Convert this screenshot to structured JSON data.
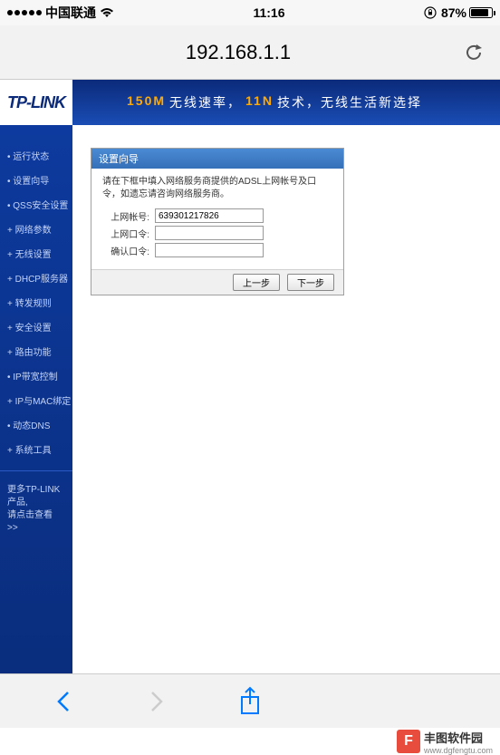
{
  "status": {
    "carrier": "中国联通",
    "time": "11:16",
    "battery_pct": "87%"
  },
  "browser": {
    "url": "192.168.1.1"
  },
  "router": {
    "logo": "TP-LINK",
    "banner": {
      "h1": "150M",
      "t1": "无线速率，",
      "h2": "11N",
      "t2": "技术，无线生活新选择"
    },
    "sidebar": {
      "items": [
        "运行状态",
        "设置向导",
        "QSS安全设置",
        "网络参数",
        "无线设置",
        "DHCP服务器",
        "转发规则",
        "安全设置",
        "路由功能",
        "IP带宽控制",
        "IP与MAC绑定",
        "动态DNS",
        "系统工具"
      ],
      "more_line1": "更多TP-LINK产品,",
      "more_line2": "请点击查看 >>"
    },
    "wizard": {
      "header": "设置向导",
      "hint": "请在下框中填入网络服务商提供的ADSL上网帐号及口令，如遗忘请咨询网络服务商。",
      "labels": {
        "account": "上网帐号:",
        "password": "上网口令:",
        "confirm": "确认口令:"
      },
      "values": {
        "account": "639301217826",
        "password": "",
        "confirm": ""
      },
      "btn_prev": "上一步",
      "btn_next": "下一步"
    }
  },
  "watermark": {
    "letter": "F",
    "text": "丰图软件园",
    "url": "www.dgfengtu.com"
  }
}
